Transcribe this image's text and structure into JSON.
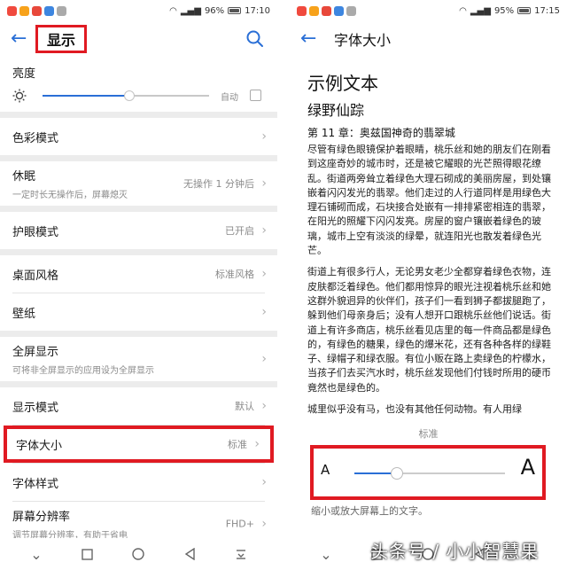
{
  "left": {
    "status": {
      "battery": "96%",
      "time": "17:10"
    },
    "title": "显示",
    "brightness": {
      "label": "亮度",
      "auto_label": "自动",
      "level": 0.52
    },
    "groups": [
      [
        {
          "label": "色彩模式"
        }
      ],
      [
        {
          "label": "休眠",
          "sub": "一定时长无操作后，屏幕熄灭",
          "value": "无操作 1 分钟后"
        }
      ],
      [
        {
          "label": "护眼模式",
          "value": "已开启"
        }
      ],
      [
        {
          "label": "桌面风格",
          "value": "标准风格"
        },
        {
          "label": "壁纸"
        }
      ],
      [
        {
          "label": "全屏显示",
          "sub": "可将非全屏显示的应用设为全屏显示"
        }
      ],
      [
        {
          "label": "显示模式",
          "value": "默认"
        },
        {
          "label": "字体大小",
          "value": "标准",
          "selected": true
        },
        {
          "label": "字体样式"
        },
        {
          "label": "屏幕分辨率",
          "sub": "调节屏幕分辨率，有助于省电",
          "value": "FHD+"
        }
      ]
    ]
  },
  "right": {
    "status": {
      "battery": "95%",
      "time": "17:15"
    },
    "title": "字体大小",
    "sample_heading": "示例文本",
    "book_title": "绿野仙踪",
    "chapter": "第 11 章：奥兹国神奇的翡翠城",
    "paragraphs": [
      "尽管有绿色眼镜保护着眼睛，桃乐丝和她的朋友们在刚看到这座奇妙的城市时，还是被它耀眼的光芒照得眼花缭乱。街道两旁耸立着绿色大理石砌成的美丽房屋，到处镶嵌着闪闪发光的翡翠。他们走过的人行道同样是用绿色大理石铺砌而成，石块接合处嵌有一排排紧密相连的翡翠，在阳光的照耀下闪闪发亮。房屋的窗户镶嵌着绿色的玻璃，城市上空有淡淡的绿晕，就连阳光也散发着绿色光芒。",
      "街道上有很多行人，无论男女老少全都穿着绿色衣物，连皮肤都泛着绿色。他们都用惊异的眼光注视着桃乐丝和她这群外貌迥异的伙伴们，孩子们一看到狮子都拔腿跑了，躲到他们母亲身后；没有人想开口跟桃乐丝他们说话。街道上有许多商店，桃乐丝看见店里的每一件商品都是绿色的，有绿色的糖果，绿色的爆米花，还有各种各样的绿鞋子、绿帽子和绿衣服。有位小贩在路上卖绿色的柠檬水，当孩子们去买汽水时，桃乐丝发现他们付钱时所用的硬币竟然也是绿色的。",
      "城里似乎没有马，也没有其他任何动物。有人用绿"
    ],
    "level_label": "标准",
    "small_a": "A",
    "large_a": "A",
    "font_level": 0.28,
    "hint": "缩小或放大屏幕上的文字。"
  },
  "watermark": "头条号 / 小小智慧果",
  "colors": {
    "accent": "#2a6fd6",
    "highlight": "#e01a22"
  }
}
